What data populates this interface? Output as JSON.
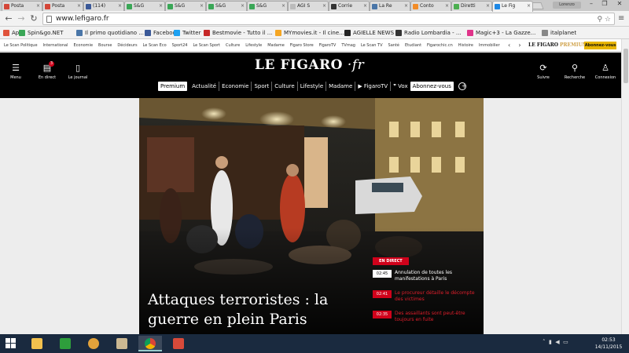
{
  "browser": {
    "tabs": [
      {
        "label": "Posta",
        "fav": "#d44638",
        "icon": "gmail-icon"
      },
      {
        "label": "Posta",
        "fav": "#d44638",
        "icon": "gmail-icon"
      },
      {
        "label": "(114)",
        "fav": "#3b5998",
        "icon": "facebook-icon"
      },
      {
        "label": "S&G",
        "fav": "#3aa757",
        "icon": "sg-icon"
      },
      {
        "label": "S&G",
        "fav": "#3aa757",
        "icon": "sg-icon"
      },
      {
        "label": "S&G",
        "fav": "#3aa757",
        "icon": "sg-icon"
      },
      {
        "label": "S&G",
        "fav": "#3aa757",
        "icon": "sg-icon"
      },
      {
        "label": "AGI S",
        "fav": "#bbbbbb",
        "icon": "page-icon"
      },
      {
        "label": "Corrie",
        "fav": "#333333",
        "icon": "corriere-icon"
      },
      {
        "label": "La Re",
        "fav": "#4a76a8",
        "icon": "repubblica-icon"
      },
      {
        "label": "Conto",
        "fav": "#f28c28",
        "icon": "chart-icon"
      },
      {
        "label": "Diretti",
        "fav": "#4caf50",
        "icon": "diretta-icon"
      },
      {
        "label": "Le Fig",
        "fav": "#1e88e5",
        "icon": "lefigaro-icon",
        "active": true
      }
    ],
    "user_chip": "Lorenzo",
    "url": "www.lefigaro.fr",
    "bookmarks": [
      {
        "label": "App",
        "fav": "#e0533c"
      },
      {
        "label": "Spin&go.NET",
        "fav": "#3aa757"
      },
      {
        "label": "Il primo quotidiano ...",
        "fav": "#4a76a8"
      },
      {
        "label": "Facebook",
        "fav": "#3b5998"
      },
      {
        "label": "Twitter",
        "fav": "#1da1f2"
      },
      {
        "label": "Bestmovie - Tutto il ...",
        "fav": "#c62828"
      },
      {
        "label": "MYmovies.it - Il cine...",
        "fav": "#f5a623"
      },
      {
        "label": "AGIELLE NEWS",
        "fav": "#222222"
      },
      {
        "label": "Radio Lombardia - ...",
        "fav": "#333333"
      },
      {
        "label": "Magic+3 - La Gazze...",
        "fav": "#e0338a"
      },
      {
        "label": "italplanet",
        "fav": "#888888"
      }
    ]
  },
  "site": {
    "topnav_items": [
      "Le Scan Politique",
      "International",
      "Economie",
      "Bourse",
      "Décideurs",
      "Le Scan Eco",
      "Sport24",
      "Le Scan Sport",
      "Culture",
      "Lifestyle",
      "Madame",
      "Figaro Store",
      "FigaroTV",
      "TVmag",
      "Le Scan TV",
      "Santé",
      "Etudiant",
      "Figarochic.cn",
      "Histoire",
      "Immobilier"
    ],
    "premium_brand": {
      "name": "LE FIGARO",
      "tier": "PREMIUM"
    },
    "abonnez_label": "Abonnez-vous",
    "menu_label": "Menu",
    "live_label": "En direct",
    "live_count": "3",
    "journal_label": "Le journal",
    "logo": {
      "name": "LE FIGARO",
      "tld": "fr"
    },
    "follow_label": "Suivre",
    "search_label": "Recherche",
    "login_label": "Connexion",
    "mainnav": [
      "Premium",
      "Actualité",
      "Economie",
      "Sport",
      "Culture",
      "Lifestyle",
      "Madame",
      "▶ FigaroTV",
      "❞ Vox",
      "Abonnez-vous"
    ],
    "headline": "Attaques terroristes : la guerre en plein Paris",
    "live_badge": "EN DIRECT",
    "live_items": [
      {
        "time": "02:45",
        "text": "Annulation de toutes les manifestations à Paris",
        "style": "white"
      },
      {
        "time": "02:41",
        "text": "Le procureur détaille le décompte des victimes",
        "style": "red"
      },
      {
        "time": "02:35",
        "text": "Des assaillants sont peut-être toujours en fuite",
        "style": "red"
      }
    ]
  },
  "taskbar": {
    "clock_time": "02:53",
    "clock_date": "14/11/2015",
    "apps": [
      "explorer-icon",
      "store-icon",
      "paint-icon",
      "notepad-icon",
      "chrome-icon",
      "calendar-icon"
    ]
  }
}
